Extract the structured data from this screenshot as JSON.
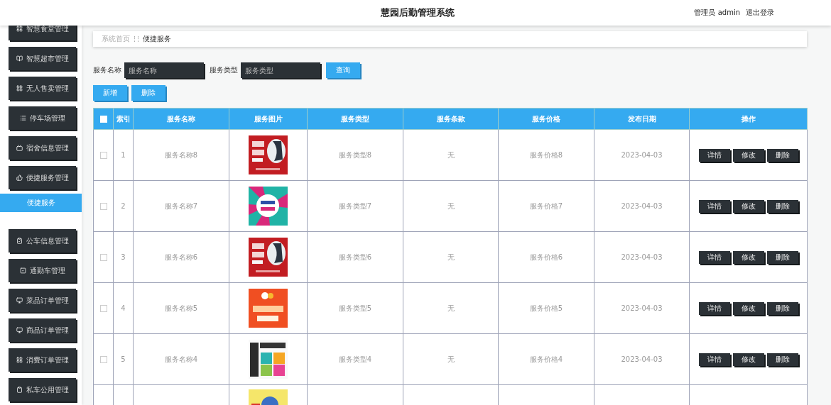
{
  "header": {
    "title": "慧园后勤管理系统",
    "user_label": "管理员 admin",
    "logout": "退出登录"
  },
  "sidebar": {
    "items": [
      {
        "label": "智慧食堂管理",
        "selected": false
      },
      {
        "label": "智慧超市管理",
        "selected": false
      },
      {
        "label": "无人售卖管理",
        "selected": false
      },
      {
        "label": "停车场管理",
        "selected": false
      },
      {
        "label": "宿舍信息管理",
        "selected": false
      },
      {
        "label": "便捷服务管理",
        "selected": false,
        "children": [
          {
            "label": "便捷服务",
            "selected": true
          }
        ]
      },
      {
        "label": "公车信息管理",
        "selected": false
      },
      {
        "label": "通勤车管理",
        "selected": false
      },
      {
        "label": "菜品订单管理",
        "selected": false
      },
      {
        "label": "商品订单管理",
        "selected": false
      },
      {
        "label": "消费订单管理",
        "selected": false
      },
      {
        "label": "私车公用管理",
        "selected": false
      }
    ]
  },
  "breadcrumb": [
    "系统首页",
    "便捷服务"
  ],
  "search": {
    "fields": [
      {
        "label": "服务名称",
        "placeholder": "服务名称"
      },
      {
        "label": "服务类型",
        "placeholder": "服务类型"
      }
    ],
    "button": "查询"
  },
  "actions": [
    "新增",
    "删除"
  ],
  "table": {
    "select_all": {
      "checked": false
    },
    "columns": [
      "索引",
      "服务名称",
      "服务图片",
      "服务类型",
      "服务条款",
      "服务价格",
      "发布日期",
      "操作"
    ],
    "rows": [
      {
        "checked": false,
        "index": "1",
        "name": "服务名称8",
        "type": "服务类型8",
        "terms": "无",
        "price": "服务价格8",
        "date": "2023-04-03",
        "buttons": [
          "详情",
          "修改",
          "删除"
        ]
      },
      {
        "checked": false,
        "index": "2",
        "name": "服务名称7",
        "type": "服务类型7",
        "terms": "无",
        "price": "服务价格7",
        "date": "2023-04-03",
        "buttons": [
          "详情",
          "修改",
          "删除"
        ]
      },
      {
        "checked": false,
        "index": "3",
        "name": "服务名称6",
        "type": "服务类型6",
        "terms": "无",
        "price": "服务价格6",
        "date": "2023-04-03",
        "buttons": [
          "详情",
          "修改",
          "删除"
        ]
      },
      {
        "checked": false,
        "index": "4",
        "name": "服务名称5",
        "type": "服务类型5",
        "terms": "无",
        "price": "服务价格5",
        "date": "2023-04-03",
        "buttons": [
          "详情",
          "修改",
          "删除"
        ]
      },
      {
        "checked": false,
        "index": "5",
        "name": "服务名称4",
        "type": "服务类型4",
        "terms": "无",
        "price": "服务价格4",
        "date": "2023-04-03",
        "buttons": [
          "详情",
          "修改",
          "删除"
        ]
      }
    ]
  }
}
